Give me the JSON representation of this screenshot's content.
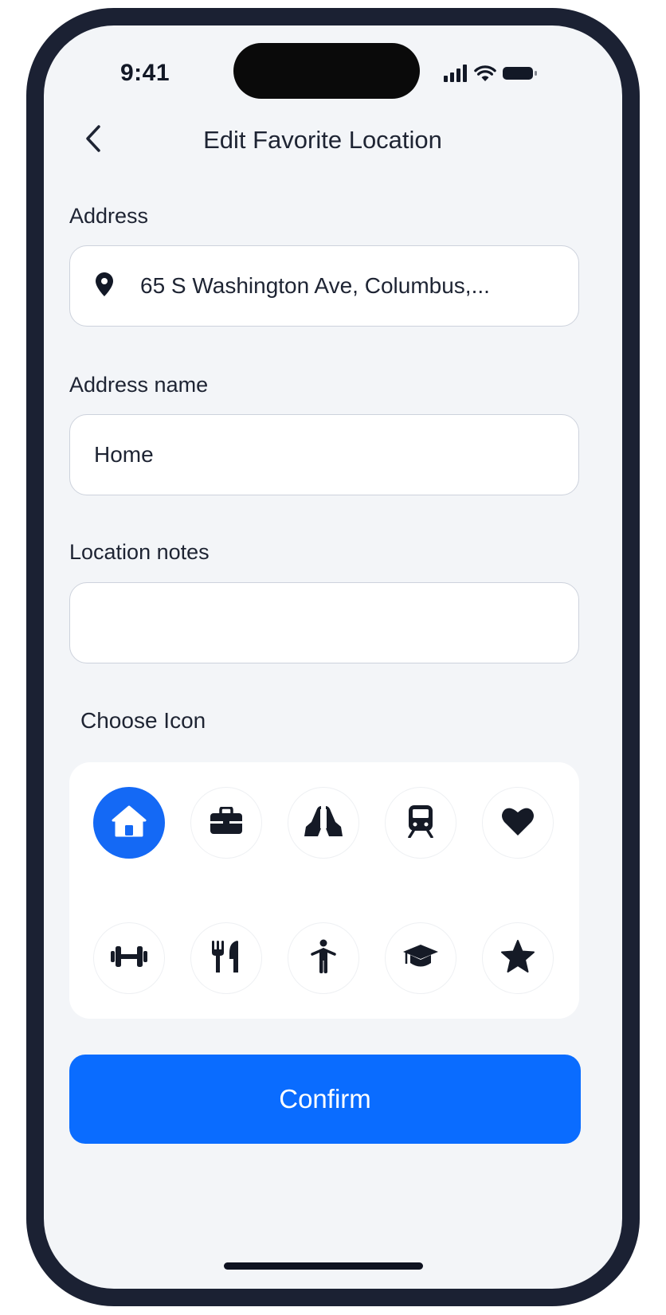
{
  "status_bar": {
    "time": "9:41",
    "icons": [
      "signal-icon",
      "wifi-icon",
      "battery-icon"
    ]
  },
  "header": {
    "title": "Edit Favorite Location",
    "back_icon": "chevron-left-icon"
  },
  "address": {
    "label": "Address",
    "value": "65 S Washington Ave, Columbus,...",
    "icon": "map-pin-icon"
  },
  "address_name": {
    "label": "Address name",
    "value": "Home"
  },
  "location_notes": {
    "label": "Location notes",
    "value": ""
  },
  "choose_icon": {
    "label": "Choose Icon",
    "selected": "home",
    "icons": [
      "home",
      "briefcase",
      "praying-hands",
      "train",
      "heart",
      "dumbbell",
      "utensils",
      "person",
      "graduation-cap",
      "star"
    ]
  },
  "confirm": {
    "label": "Confirm"
  },
  "colors": {
    "accent": "#0a6cff",
    "selected_icon_bg": "#1469f5",
    "frame": "#1b2133",
    "screen_bg": "#f3f5f8",
    "text": "#1e2433"
  }
}
